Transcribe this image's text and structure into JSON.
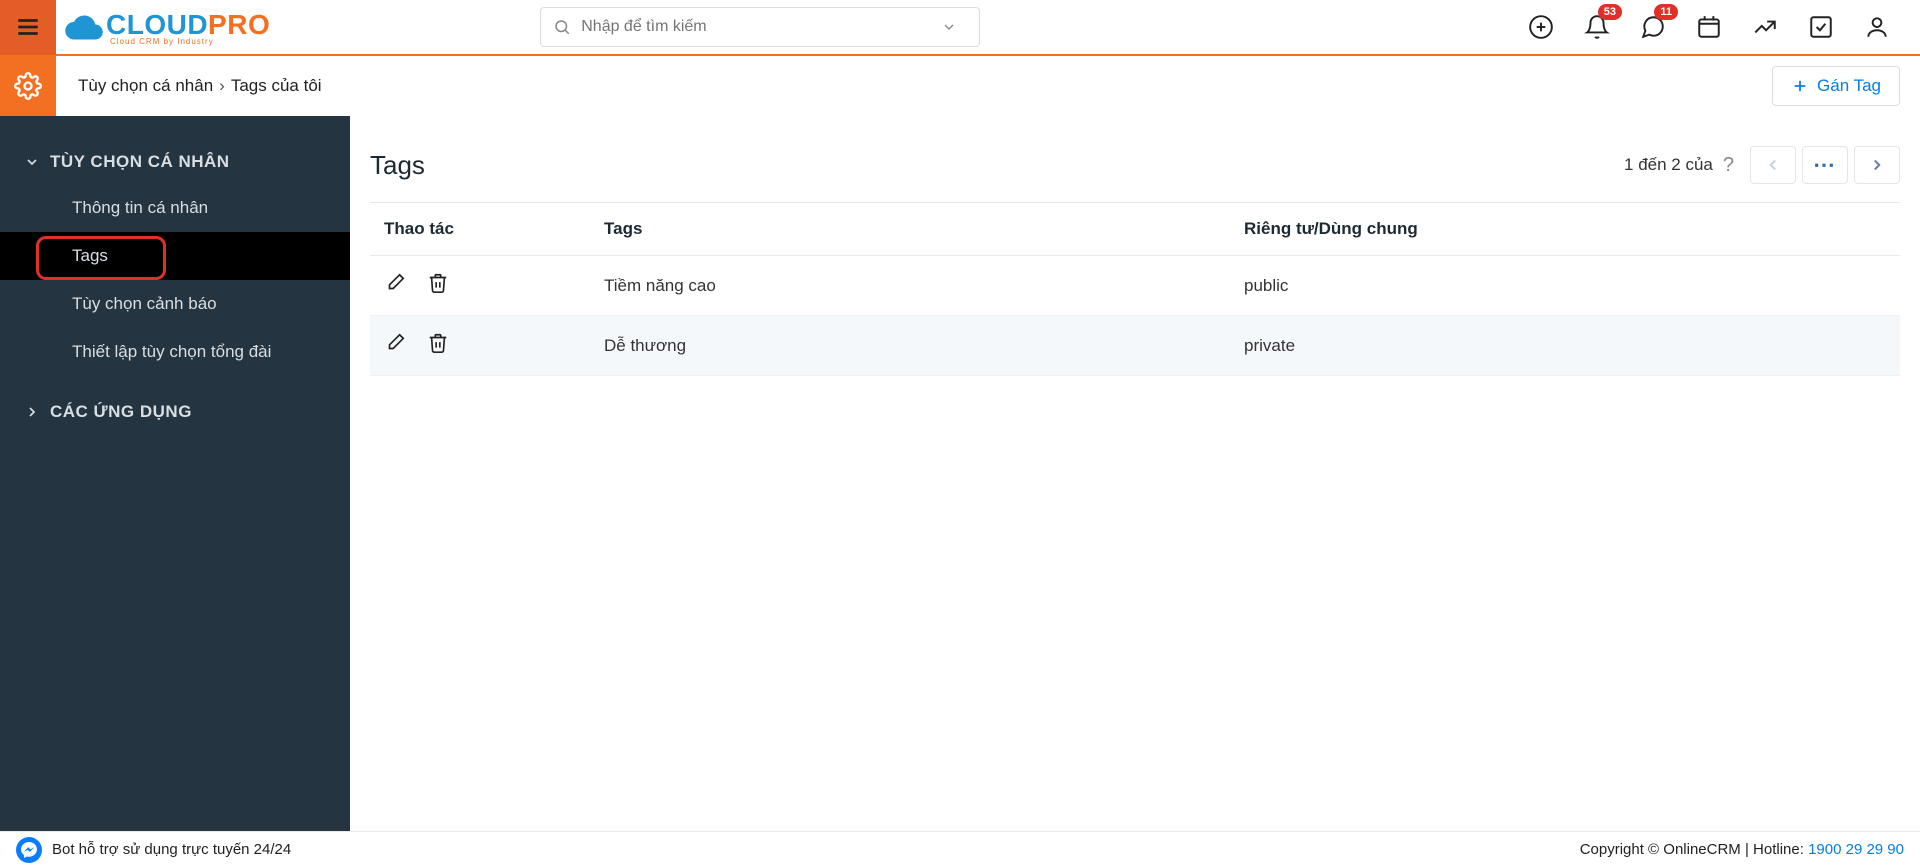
{
  "search": {
    "placeholder": "Nhập để tìm kiếm"
  },
  "badges": {
    "bell": "53",
    "chat": "11"
  },
  "breadcrumb": {
    "a": "Tùy chọn cá nhân",
    "b": "Tags của tôi"
  },
  "assign_button": "Gán Tag",
  "sidebar": {
    "group1_title": "TÙY CHỌN CÁ NHÂN",
    "items1": [
      {
        "label": "Thông tin cá nhân"
      },
      {
        "label": "Tags"
      },
      {
        "label": "Tùy chọn cảnh báo"
      },
      {
        "label": "Thiết lập tùy chọn tổng đài"
      }
    ],
    "group2_title": "CÁC ỨNG DỤNG"
  },
  "content": {
    "title": "Tags",
    "pagination": "1 đến 2 của",
    "columns": {
      "actions": "Thao tác",
      "tag": "Tags",
      "visibility": "Riêng tư/Dùng chung"
    },
    "rows": [
      {
        "tag": "Tiềm năng cao",
        "visibility": "public"
      },
      {
        "tag": "Dễ thương",
        "visibility": "private"
      }
    ]
  },
  "footer": {
    "bot": "Bot hỗ trợ sử dụng trực tuyến 24/24",
    "copyright": "Copyright © OnlineCRM",
    "hotline_label": "Hotline:",
    "hotline_number": "1900 29 29 90"
  }
}
